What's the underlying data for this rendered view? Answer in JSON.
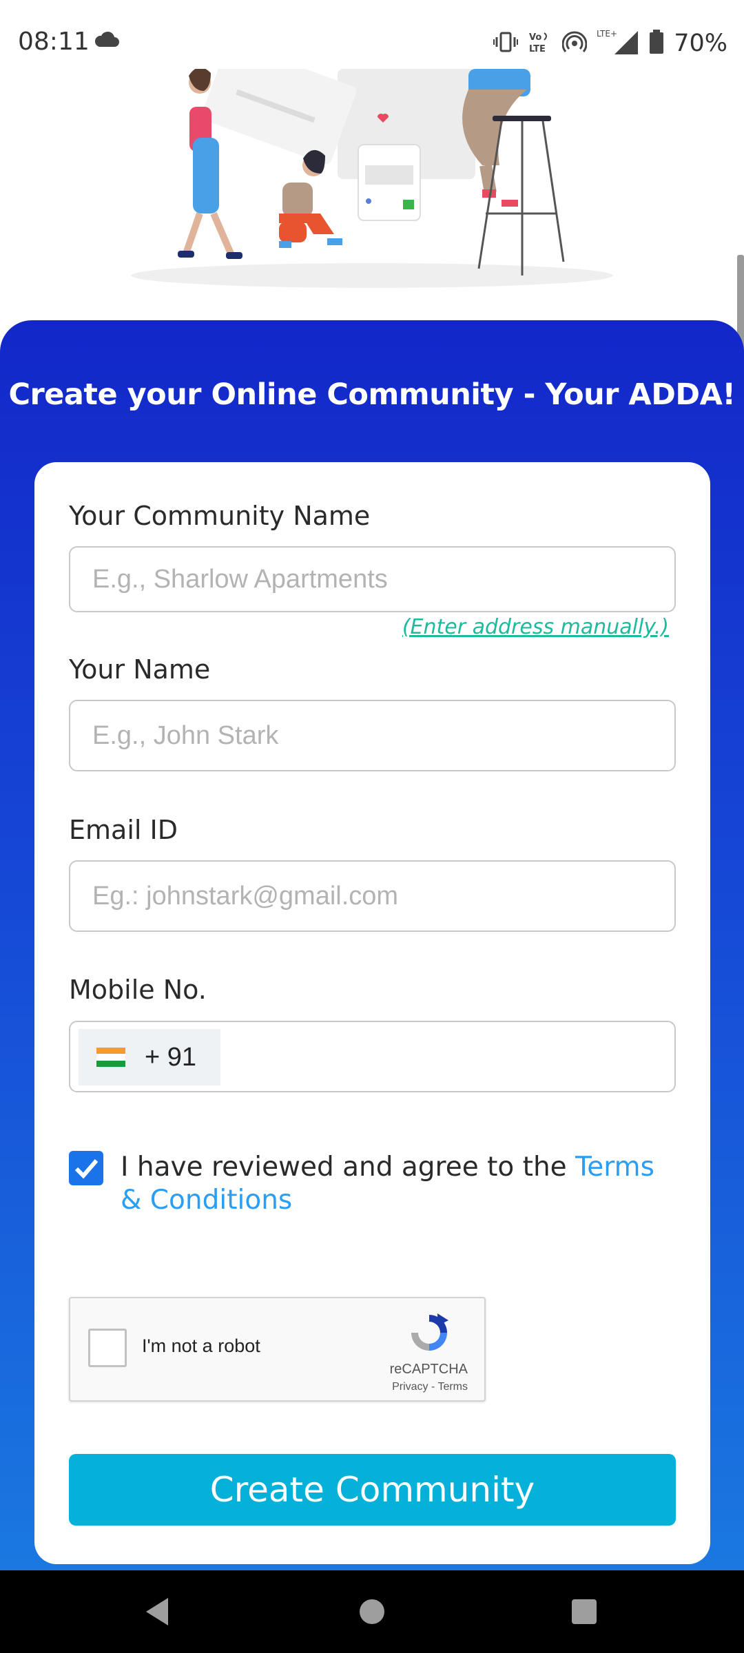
{
  "status_bar": {
    "time": "08:11",
    "battery": "70%",
    "network": "LTE+"
  },
  "header": {
    "title": "Create your Online Community - Your ADDA!"
  },
  "form": {
    "community_name": {
      "label": "Your Community Name",
      "placeholder": "E.g., Sharlow Apartments",
      "manual_address_link": "(Enter address manually.)"
    },
    "your_name": {
      "label": "Your Name",
      "placeholder": "E.g., John Stark"
    },
    "email": {
      "label": "Email ID",
      "placeholder": "Eg.: johnstark@gmail.com"
    },
    "mobile": {
      "label": "Mobile No.",
      "dial_code": "+ 91"
    },
    "agreement": {
      "text": "I have reviewed and agree to the ",
      "terms_link": "Terms & Conditions",
      "checked": true
    },
    "recaptcha": {
      "label": "I'm not a robot",
      "brand": "reCAPTCHA",
      "links": "Privacy - Terms"
    },
    "submit_label": "Create Community"
  },
  "colors": {
    "panel_top": "#1327c9",
    "panel_bottom": "#1a78e0",
    "button": "#05b1d9",
    "link_green": "#1fba9e",
    "link_blue": "#2a9df4",
    "checkbox": "#1a73e8"
  },
  "icons": {
    "status": [
      "cloud-icon",
      "vibrate-icon",
      "volte-icon",
      "hotspot-icon",
      "signal-icon",
      "battery-icon"
    ],
    "nav": [
      "back-icon",
      "home-icon",
      "recents-icon"
    ]
  }
}
